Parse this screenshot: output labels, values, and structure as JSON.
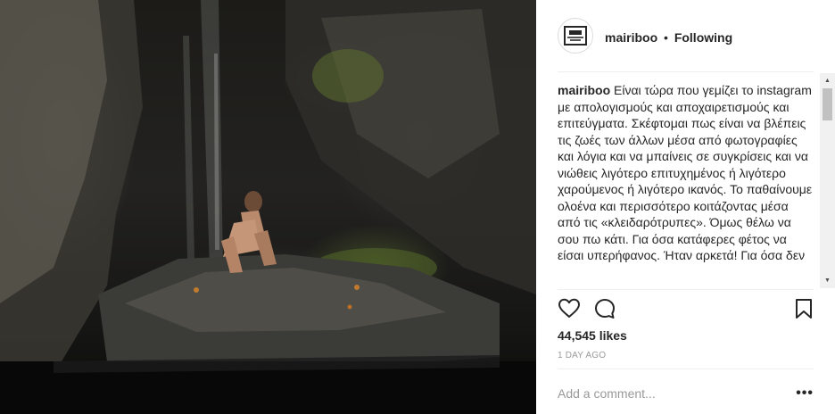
{
  "post": {
    "username": "mairiboo",
    "separator": "•",
    "follow_status": "Following",
    "avatar_text": "[logo]",
    "caption_text": "Είναι τώρα που γεμίζει το instagram με απολογισμούς και αποχαιρετισμούς και επιτεύγματα. Σκέφτομαι πως είναι να βλέπεις τις ζωές των άλλων μέσα από φωτογραφίες και λόγια και να μπαίνεις σε συγκρίσεις και να νιώθεις λιγότερο επιτυχημένος ή λιγότερο χαρούμενος ή λιγότερο ικανός. Το παθαίνουμε ολοένα και περισσότερο κοιτάζοντας μέσα από τις «κλειδαρότρυπες». Όμως θέλω να σου πω κάτι. Για όσα κατάφερες φέτος να είσαι υπερήφανος. Ήταν αρκετά! Για όσα δεν",
    "likes": "44,545 likes",
    "date": "1 DAY AGO",
    "comment_placeholder": "Add a comment...",
    "more_options": "•••"
  },
  "icons": {
    "like": "heart-icon",
    "comment": "comment-icon",
    "save": "bookmark-icon",
    "scroll_up": "scroll-up-arrow",
    "scroll_down": "scroll-down-arrow"
  },
  "colors": {
    "text": "#262626",
    "muted": "#999999",
    "divider": "#efefef"
  }
}
